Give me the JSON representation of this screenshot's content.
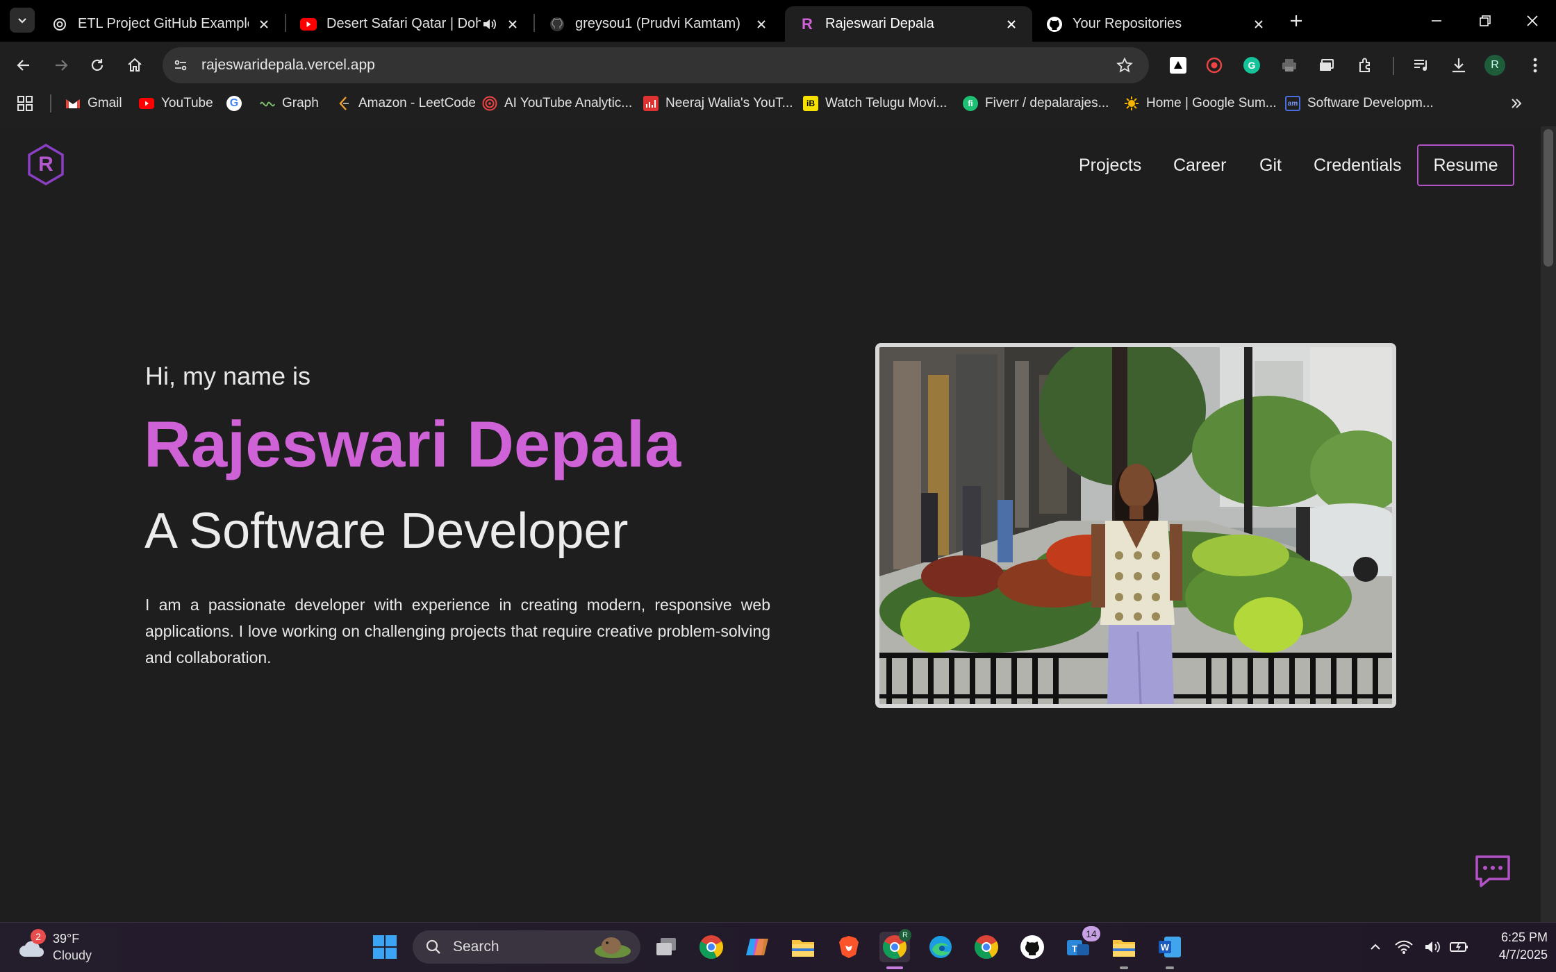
{
  "browser": {
    "tabs": [
      {
        "title": "ETL Project GitHub Example",
        "icon": "openai-icon",
        "active": false
      },
      {
        "title": "Desert Safari Qatar | Doha C",
        "icon": "youtube-icon",
        "active": false,
        "audio": true
      },
      {
        "title": "greysou1 (Prudvi Kamtam)",
        "icon": "github-icon",
        "active": false
      },
      {
        "title": "Rajeswari Depala",
        "icon": "r-logo-icon",
        "active": true
      },
      {
        "title": "Your Repositories",
        "icon": "github-icon",
        "active": false
      }
    ],
    "url": "rajeswaridepala.vercel.app",
    "profile_initial": "R",
    "bookmarks": [
      {
        "label": "Gmail",
        "icon": "gmail-icon"
      },
      {
        "label": "YouTube",
        "icon": "youtube-icon"
      },
      {
        "label": "",
        "icon": "google-icon"
      },
      {
        "label": "Graph",
        "icon": "graph-icon"
      },
      {
        "label": "Amazon - LeetCode",
        "icon": "leetcode-icon"
      },
      {
        "label": "AI YouTube Analytic...",
        "icon": "analytics-icon"
      },
      {
        "label": "Neeraj Walia's YouT...",
        "icon": "chart-icon"
      },
      {
        "label": "Watch Telugu Movi...",
        "icon": "ib-icon"
      },
      {
        "label": "Fiverr / depalarajes...",
        "icon": "fiverr-icon"
      },
      {
        "label": "Home | Google Sum...",
        "icon": "sun-icon"
      },
      {
        "label": "Software Developm...",
        "icon": "dev-icon"
      }
    ]
  },
  "site": {
    "logo_letter": "R",
    "nav": [
      "Projects",
      "Career",
      "Git",
      "Credentials"
    ],
    "resume_label": "Resume",
    "hero": {
      "greeting": "Hi, my name is",
      "name": "Rajeswari Depala",
      "role": "A Software Developer",
      "description": "I am a passionate developer with experience in creating modern, responsive web applications. I love working on challenging projects that require creative problem-solving and collaboration."
    },
    "accent_color": "#cf62d6"
  },
  "taskbar": {
    "weather_temp": "39°F",
    "weather_desc": "Cloudy",
    "weather_badge": "2",
    "search_placeholder": "Search",
    "teams_badge": "14",
    "time": "6:25 PM",
    "date": "4/7/2025"
  }
}
